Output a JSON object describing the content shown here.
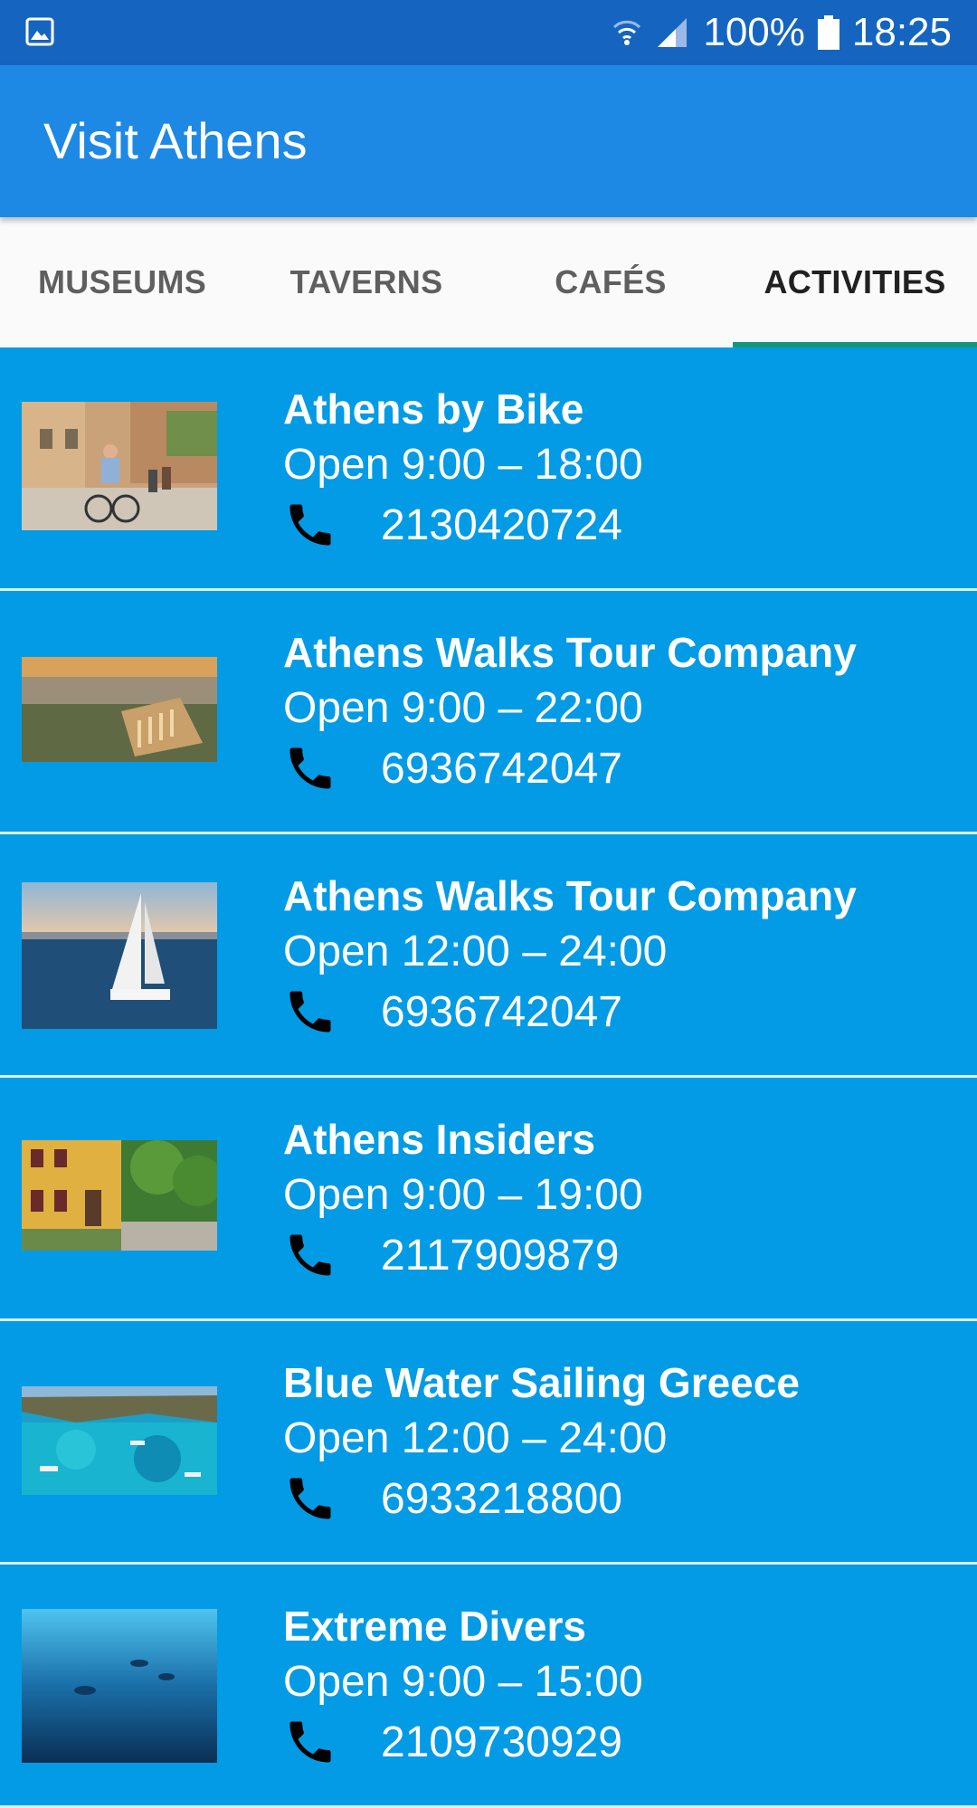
{
  "status_bar": {
    "battery": "100%",
    "time": "18:25"
  },
  "app": {
    "title": "Visit Athens"
  },
  "tabs": [
    {
      "label": "MUSEUMS",
      "active": false
    },
    {
      "label": "TAVERNS",
      "active": false
    },
    {
      "label": "CAFÉS",
      "active": false
    },
    {
      "label": "ACTIVITIES",
      "active": true
    }
  ],
  "activities": [
    {
      "name": "Athens by Bike",
      "hours": "Open 9:00 – 18:00",
      "phone": "2130420724",
      "image": "bike-street-photo"
    },
    {
      "name": "Athens Walks Tour Company",
      "hours": "Open 9:00 – 22:00",
      "phone": "6936742047",
      "image": "aerial-ruins-photo"
    },
    {
      "name": "Athens Walks Tour Company",
      "hours": "Open 12:00 – 24:00",
      "phone": "6936742047",
      "image": "sailboat-photo"
    },
    {
      "name": "Athens Insiders",
      "hours": "Open 9:00 – 19:00",
      "phone": "2117909879",
      "image": "yellow-house-street-photo"
    },
    {
      "name": "Blue Water Sailing Greece",
      "hours": "Open 12:00 – 24:00",
      "phone": "6933218800",
      "image": "turquoise-bay-photo"
    },
    {
      "name": "Extreme Divers",
      "hours": "Open 9:00 – 15:00",
      "phone": "2109730929",
      "image": "underwater-divers-photo"
    }
  ],
  "colors": {
    "status_bar": "#1565C0",
    "app_bar": "#1E88E5",
    "list_background": "#039BE5",
    "tab_indicator": "#13977B"
  }
}
